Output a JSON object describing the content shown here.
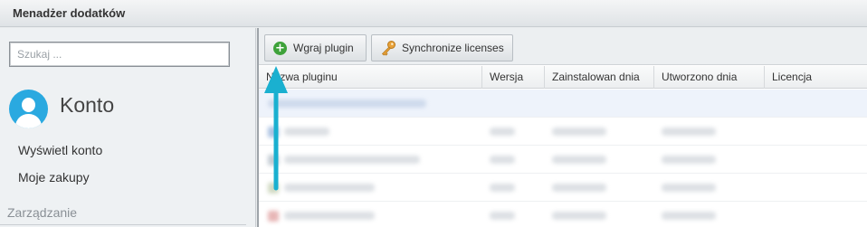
{
  "app": {
    "title": "Menadżer dodatków"
  },
  "sidebar": {
    "search_placeholder": "Szukaj ...",
    "account_title": "Konto",
    "items": [
      {
        "label": "Wyświetl konto"
      },
      {
        "label": "Moje zakupy"
      }
    ],
    "section": "Zarządzanie"
  },
  "toolbar": {
    "upload_label": "Wgraj plugin",
    "sync_label": "Synchronize licenses"
  },
  "table": {
    "columns": [
      "Nazwa pluginu",
      "Wersja",
      "Zainstalowan dnia",
      "Utworzono dnia",
      "Licencja"
    ]
  },
  "annotation": {
    "arrow_color": "#1ab0d0"
  },
  "icons": {
    "upload": "plus-circle-icon",
    "sync": "key-icon",
    "avatar": "user-avatar-icon"
  }
}
